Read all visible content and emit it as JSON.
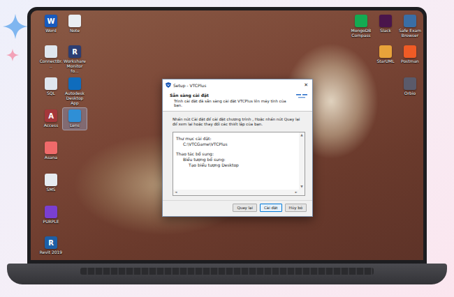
{
  "desktop_icons": {
    "left": [
      {
        "label": "Word",
        "glyph": "W",
        "color": "#185abd",
        "selected": false
      },
      {
        "label": "Note",
        "color": "#e9eef3",
        "selected": false
      },
      {
        "label": "ConnectBr...",
        "color": "#dfe6ee",
        "selected": false
      },
      {
        "label": "Workshare Monitor fo...",
        "glyph": "R",
        "color": "#2c3e73",
        "selected": false
      },
      {
        "label": "SQL",
        "color": "#dfe6ee",
        "selected": false
      },
      {
        "label": "Autodesk Desktop App",
        "color": "#0f6cbd",
        "selected": false
      },
      {
        "label": "Access",
        "glyph": "A",
        "color": "#a4373a",
        "selected": false
      },
      {
        "label": "Lens",
        "color": "#2f8fd6",
        "selected": true
      },
      {
        "label": "Asana",
        "color": "#f06a6a",
        "selected": false
      },
      {
        "label": "SMS",
        "color": "#e6ebf0",
        "selected": false
      },
      {
        "label": "PURPLE",
        "color": "#7a3fd0",
        "selected": false
      },
      {
        "label": "Revit 2019",
        "glyph": "R",
        "color": "#1d5fa6",
        "selected": false
      }
    ],
    "right": [
      {
        "label": "MongoDB Compass",
        "color": "#13aa52",
        "selected": false
      },
      {
        "label": "Slack",
        "color": "#4a154b",
        "selected": false
      },
      {
        "label": "Safe Exam Browser",
        "color": "#3a6ea5",
        "selected": false
      },
      {
        "label": "StarUML",
        "color": "#e8a33a",
        "selected": false
      },
      {
        "label": "Postman",
        "color": "#ef5b25",
        "selected": false
      },
      {
        "label": "Orbio",
        "color": "#5a5a6a",
        "selected": false
      }
    ]
  },
  "dialog": {
    "title": "Setup - VTCPlus",
    "close": "✕",
    "header": {
      "title": "Sẵn sàng cài đặt",
      "subtitle": "Trình cài đặt đã sẵn sàng cài đặt VTCPlus lên máy tính của bạn."
    },
    "message": "Nhấn nút Cài đặt để cài đặt chương trình , Hoặc nhấn nút Quay lại để xem lại hoặc thay đổi các thiết lập của bạn.",
    "summary": [
      {
        "label": "Thư mục cài đặt:",
        "lines": [
          {
            "text": "C:\\VTCGame\\VTCPlus",
            "kind": "item"
          }
        ]
      },
      {
        "label": "Thao tác bổ sung:",
        "lines": [
          {
            "text": "Biểu tượng bổ sung:",
            "kind": "item"
          },
          {
            "text": "Tạo biểu tượng Desktop",
            "kind": "subitem"
          }
        ]
      }
    ],
    "scroll": {
      "up": "▲",
      "down": "▼",
      "left": "◄",
      "right": "►"
    },
    "buttons": [
      {
        "label": "Quay lại",
        "selected": false
      },
      {
        "label": "Cài đặt",
        "selected": true
      },
      {
        "label": "Hủy bỏ",
        "selected": false
      }
    ]
  }
}
